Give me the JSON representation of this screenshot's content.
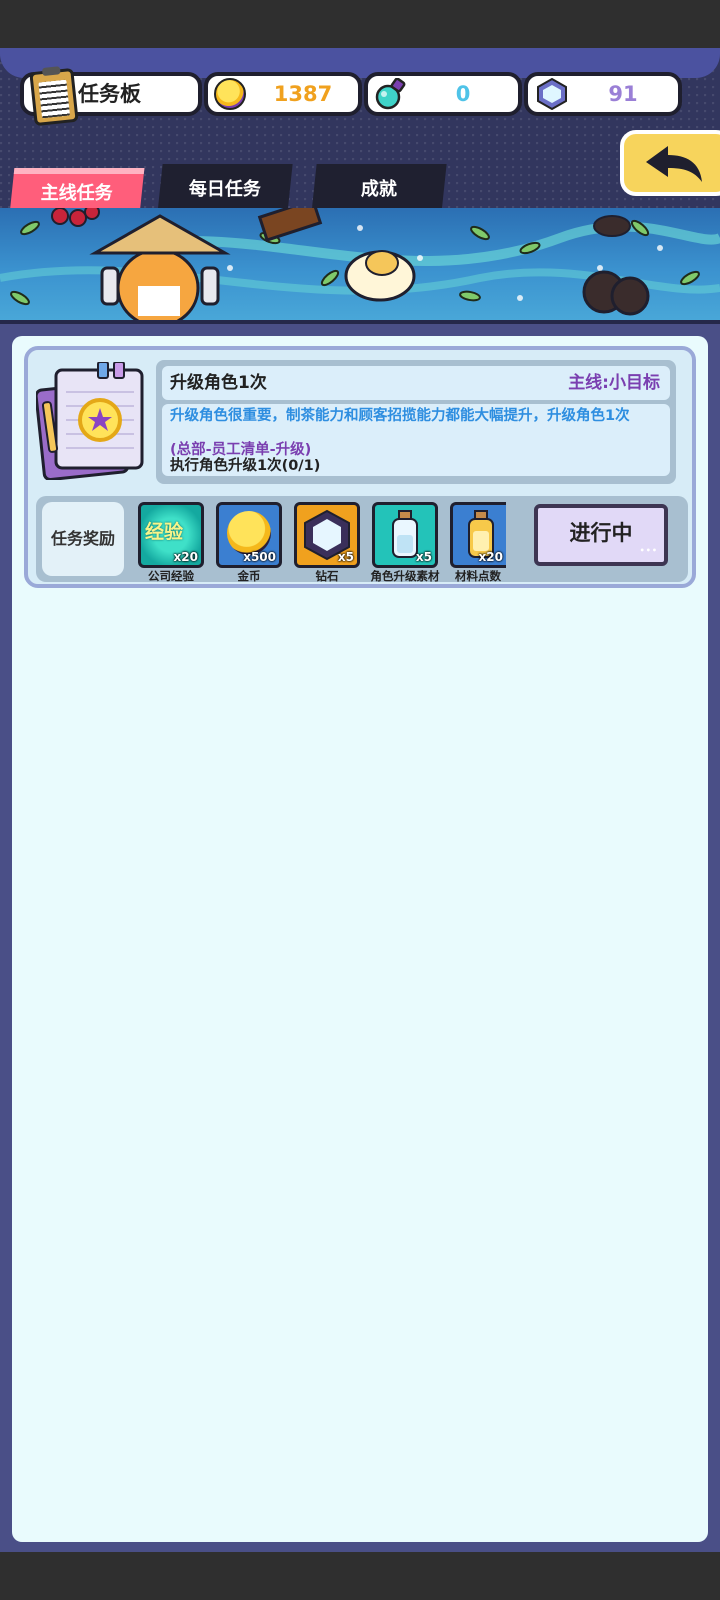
{
  "header": {
    "title": "任务板",
    "gold": "1387",
    "potion": "0",
    "gems": "91"
  },
  "tabs": [
    {
      "label": "主线任务",
      "active": true
    },
    {
      "label": "每日任务",
      "active": false
    },
    {
      "label": "成就",
      "active": false
    }
  ],
  "task": {
    "title": "升级角色1次",
    "type": "主线:小目标",
    "description": "升级角色很重要，制茶能力和顾客招揽能力都能大幅提升，升级角色1次",
    "path": "(总部-员工清单-升级)",
    "progress": "执行角色升级1次(0/1)",
    "reward_label": "任务奖励",
    "status": "进行中",
    "rewards": [
      {
        "name": "公司经验",
        "qty": "x20",
        "icon": "exp-icon",
        "icon_text": "经验"
      },
      {
        "name": "金币",
        "qty": "x500",
        "icon": "gold-coin-icon"
      },
      {
        "name": "钻石",
        "qty": "x5",
        "icon": "diamond-icon"
      },
      {
        "name": "角色升级素材",
        "qty": "x5",
        "icon": "milk-bottle-icon"
      },
      {
        "name": "材料点数",
        "qty": "x20",
        "icon": "juice-bottle-icon"
      }
    ]
  },
  "colors": {
    "frame": "#4a4f87",
    "active_tab": "#ff5e7b",
    "gold_text": "#f0a11e",
    "potion_text": "#4fc3e8",
    "gem_text": "#9a7fd6",
    "description_text": "#2e8ee0",
    "type_text": "#7a3fb0",
    "back_button": "#f7d45c"
  }
}
